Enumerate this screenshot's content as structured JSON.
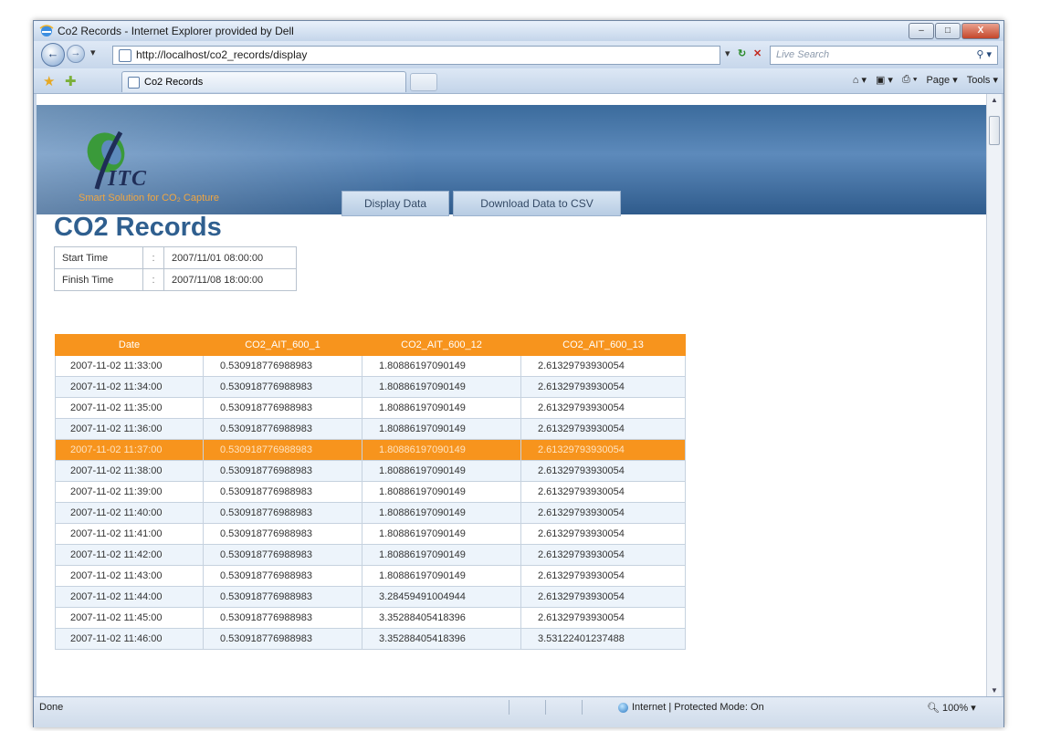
{
  "window": {
    "title": "Co2 Records - Internet Explorer provided by Dell",
    "controls": {
      "minimize": "–",
      "maximize": "□",
      "close": "X"
    }
  },
  "address_bar": {
    "url": "http://localhost/co2_records/display",
    "refresh": "↻",
    "stop": "✕",
    "search_placeholder": "Live Search"
  },
  "tab_bar": {
    "active_tab": "Co2 Records",
    "commands": [
      "Page ▾",
      "Tools ▾"
    ]
  },
  "banner": {
    "logo_text": "ITC",
    "tagline": "Smart Solution for CO₂ Capture",
    "nav": [
      "Display Data",
      "Download Data to CSV"
    ]
  },
  "page": {
    "title": "CO2 Records",
    "time_range": [
      {
        "label": "Start Time",
        "sep": ":",
        "value": "2007/11/01 08:00:00"
      },
      {
        "label": "Finish Time",
        "sep": ":",
        "value": "2007/11/08 18:00:00"
      }
    ]
  },
  "table": {
    "columns": [
      "Date",
      "CO2_AIT_600_1",
      "CO2_AIT_600_12",
      "CO2_AIT_600_13"
    ],
    "selected_row_index": 4,
    "rows": [
      [
        "2007-11-02 11:33:00",
        "0.530918776988983",
        "1.80886197090149",
        "2.61329793930054"
      ],
      [
        "2007-11-02 11:34:00",
        "0.530918776988983",
        "1.80886197090149",
        "2.61329793930054"
      ],
      [
        "2007-11-02 11:35:00",
        "0.530918776988983",
        "1.80886197090149",
        "2.61329793930054"
      ],
      [
        "2007-11-02 11:36:00",
        "0.530918776988983",
        "1.80886197090149",
        "2.61329793930054"
      ],
      [
        "2007-11-02 11:37:00",
        "0.530918776988983",
        "1.80886197090149",
        "2.61329793930054"
      ],
      [
        "2007-11-02 11:38:00",
        "0.530918776988983",
        "1.80886197090149",
        "2.61329793930054"
      ],
      [
        "2007-11-02 11:39:00",
        "0.530918776988983",
        "1.80886197090149",
        "2.61329793930054"
      ],
      [
        "2007-11-02 11:40:00",
        "0.530918776988983",
        "1.80886197090149",
        "2.61329793930054"
      ],
      [
        "2007-11-02 11:41:00",
        "0.530918776988983",
        "1.80886197090149",
        "2.61329793930054"
      ],
      [
        "2007-11-02 11:42:00",
        "0.530918776988983",
        "1.80886197090149",
        "2.61329793930054"
      ],
      [
        "2007-11-02 11:43:00",
        "0.530918776988983",
        "1.80886197090149",
        "2.61329793930054"
      ],
      [
        "2007-11-02 11:44:00",
        "0.530918776988983",
        "3.28459491004944",
        "2.61329793930054"
      ],
      [
        "2007-11-02 11:45:00",
        "0.530918776988983",
        "3.35288405418396",
        "2.61329793930054"
      ],
      [
        "2007-11-02 11:46:00",
        "0.530918776988983",
        "3.35288405418396",
        "3.53122401237488"
      ]
    ]
  },
  "status_bar": {
    "status": "Done",
    "zone": "Internet | Protected Mode: On",
    "zoom": "100%"
  },
  "colors": {
    "accent_orange": "#f7941d",
    "title_blue": "#2f5f8f"
  }
}
